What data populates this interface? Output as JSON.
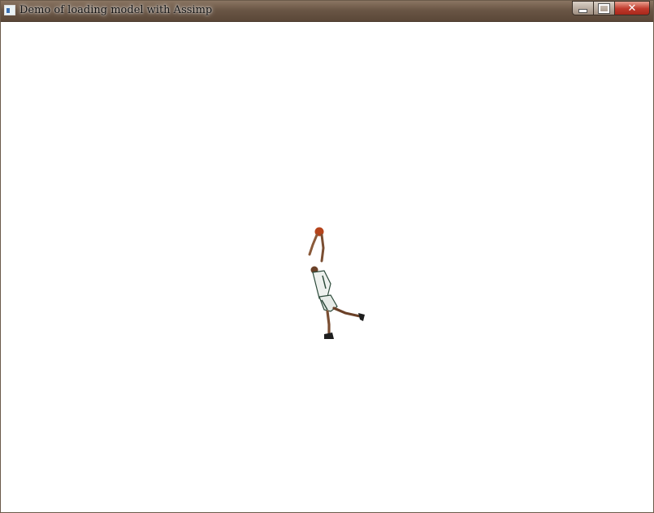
{
  "window": {
    "title": "Demo of loading model with Assimp",
    "buttons": {
      "minimize": "minimize",
      "maximize": "maximize",
      "close": "✕"
    }
  },
  "viewport": {
    "background": "#ffffff",
    "model": "basketball-player"
  },
  "colors": {
    "titlebar": "#6a5645",
    "close": "#c0392b",
    "ball": "#b5441c",
    "jersey": "#eef1ee",
    "trim": "#2c4a3a"
  }
}
